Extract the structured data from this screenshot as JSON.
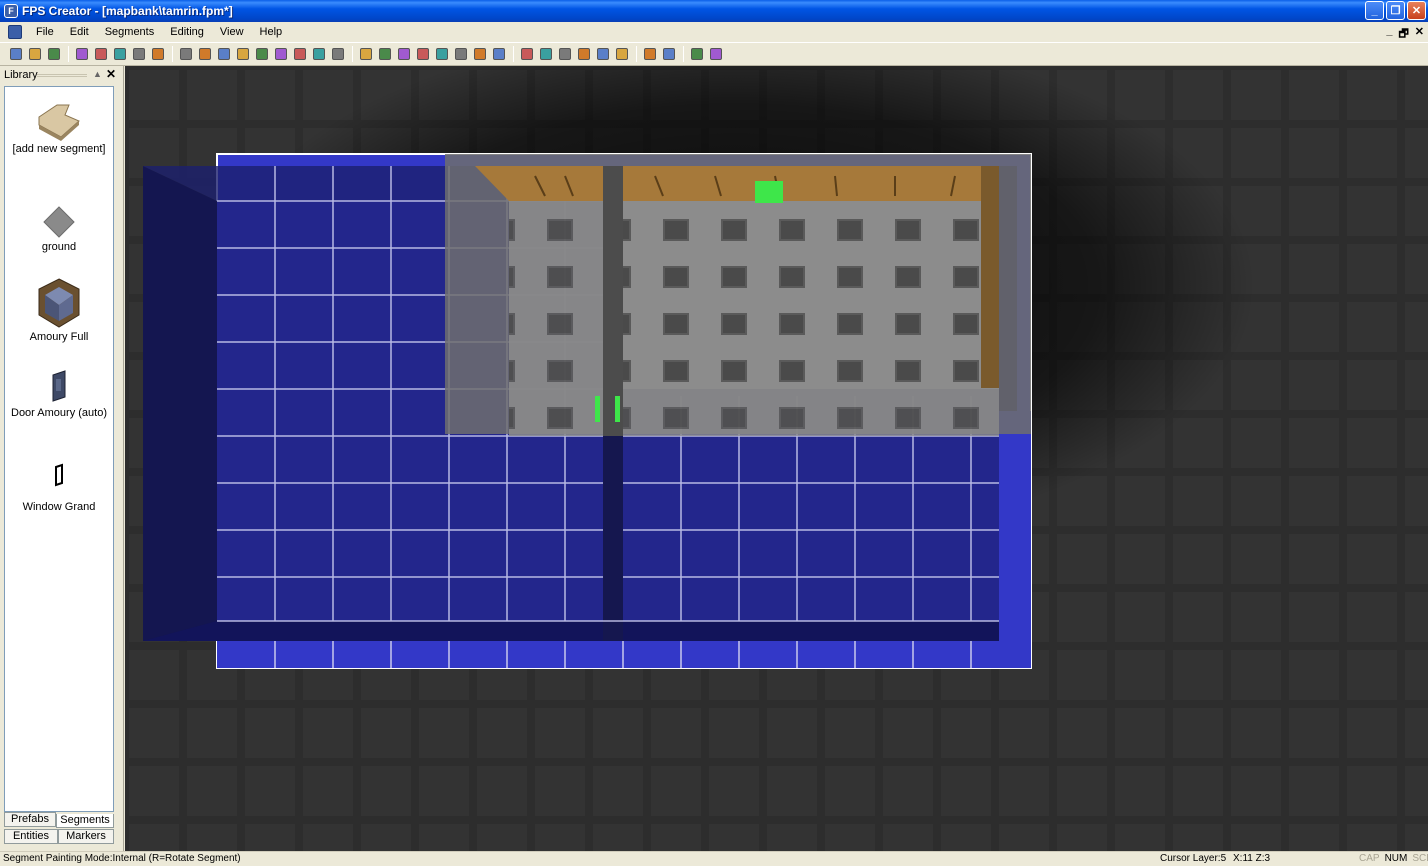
{
  "window": {
    "title": "FPS Creator - [mapbank\\tamrin.fpm*]",
    "app_icon_text": "F",
    "buttons": {
      "minimize": "_",
      "maximize": "❐",
      "close": "✕"
    }
  },
  "menu": {
    "items": [
      "File",
      "Edit",
      "Segments",
      "Editing",
      "View",
      "Help"
    ],
    "mdi_buttons": {
      "minimize": "_",
      "restore": "ð",
      "close": "✕"
    }
  },
  "toolbar": {
    "groups": [
      [
        "new-file-icon",
        "open-folder-icon",
        "save-icon"
      ],
      [
        "cut-icon",
        "copy-icon",
        "paste-icon",
        "undo-icon",
        "redo-icon"
      ],
      [
        "add-layer-icon",
        "layer-down-icon",
        "layer-view-icon",
        "layer-x-icon",
        "all-layers-icon",
        "layer-solo-icon",
        "layer-compare-icon",
        "map-view-icon",
        "zoom-icon"
      ],
      [
        "paint-segment-icon",
        "pick-segment-icon",
        "paint-brush-1-icon",
        "paint-brush-2-icon",
        "paint-brush-3-icon",
        "paint-brush-4-icon",
        "pick-tool-icon",
        "measure-icon"
      ],
      [
        "line-tool-icon",
        "rect-tool-icon",
        "circle-tool-icon",
        "fill-tool-icon",
        "pick-entity-icon",
        "entity-brush-icon"
      ],
      [
        "flag-icon",
        "flag-all-icon"
      ],
      [
        "test-game-icon",
        "build-game-icon"
      ]
    ]
  },
  "library": {
    "title": "Library",
    "pin": "▲",
    "close": "✕",
    "items": [
      {
        "label": "[add new segment]",
        "icon": "add-segment-icon"
      },
      {
        "label": "ground",
        "icon": "ground-segment-icon"
      },
      {
        "label": "Amoury Full",
        "icon": "armoury-full-icon"
      },
      {
        "label": "Door Amoury (auto)",
        "icon": "door-armoury-icon"
      },
      {
        "label": "Window Grand",
        "icon": "window-grand-icon"
      }
    ],
    "tabs": {
      "prefabs": "Prefabs",
      "segments": "Segments",
      "entities": "Entities",
      "markers": "Markers"
    }
  },
  "status": {
    "mode": "Segment Painting Mode:Internal (R=Rotate Segment)",
    "cursor_layer": "Cursor Layer:5",
    "coords": "X:11  Z:3",
    "keys": [
      {
        "label": "CAP",
        "active": false
      },
      {
        "label": "NUM",
        "active": true
      },
      {
        "label": "SCRL",
        "active": false
      }
    ]
  },
  "colors": {
    "title_bar": "#0055e5",
    "viewport_bg": "#2c2c2c",
    "blue_floor": "#2a2fa0",
    "armoury_floor": "#8a8a8a",
    "highlight_green": "#3ee64a",
    "wall_wood": "#a6793a"
  }
}
